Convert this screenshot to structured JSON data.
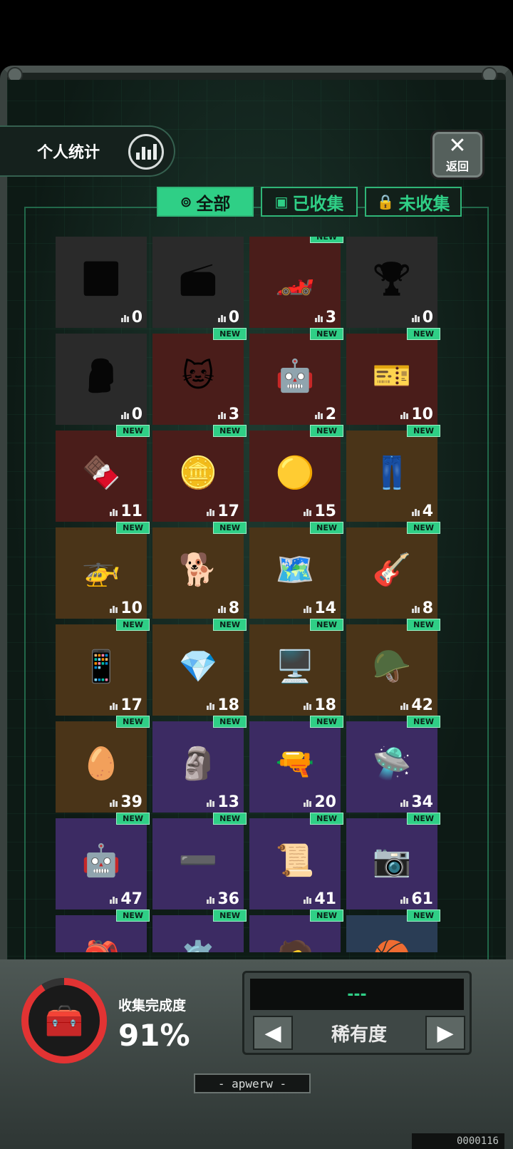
{
  "header": {
    "stats_label": "个人统计",
    "back_label": "返回"
  },
  "filters": {
    "all": "全部",
    "collected": "已收集",
    "uncollected": "未收集"
  },
  "items": [
    {
      "color": "gray",
      "icon": "🟫",
      "count": "0",
      "new": false
    },
    {
      "color": "gray",
      "icon": "📻",
      "count": "0",
      "new": false
    },
    {
      "color": "red",
      "icon": "🏎️",
      "count": "3",
      "new": true
    },
    {
      "color": "gray",
      "icon": "🏆",
      "count": "0",
      "new": false
    },
    {
      "color": "gray",
      "icon": "🗿",
      "count": "0",
      "new": false
    },
    {
      "color": "red",
      "icon": "🐱",
      "count": "3",
      "new": true
    },
    {
      "color": "red",
      "icon": "🤖",
      "count": "2",
      "new": true
    },
    {
      "color": "red",
      "icon": "🎫",
      "count": "10",
      "new": true
    },
    {
      "color": "red",
      "icon": "🍫",
      "count": "11",
      "new": true
    },
    {
      "color": "red",
      "icon": "🪙",
      "count": "17",
      "new": true
    },
    {
      "color": "red",
      "icon": "🟡",
      "count": "15",
      "new": true
    },
    {
      "color": "gold",
      "icon": "👖",
      "count": "4",
      "new": true
    },
    {
      "color": "gold",
      "icon": "🚁",
      "count": "10",
      "new": true
    },
    {
      "color": "gold",
      "icon": "🐕",
      "count": "8",
      "new": true
    },
    {
      "color": "gold",
      "icon": "🗺️",
      "count": "14",
      "new": true
    },
    {
      "color": "gold",
      "icon": "🎸",
      "count": "8",
      "new": true
    },
    {
      "color": "gold",
      "icon": "📱",
      "count": "17",
      "new": true
    },
    {
      "color": "gold",
      "icon": "💎",
      "count": "18",
      "new": true
    },
    {
      "color": "gold",
      "icon": "🖥️",
      "count": "18",
      "new": true
    },
    {
      "color": "gold",
      "icon": "🪖",
      "count": "42",
      "new": true
    },
    {
      "color": "gold",
      "icon": "🥚",
      "count": "39",
      "new": true
    },
    {
      "color": "purple",
      "icon": "🗿",
      "count": "13",
      "new": true
    },
    {
      "color": "purple",
      "icon": "🔫",
      "count": "20",
      "new": true
    },
    {
      "color": "purple",
      "icon": "🛸",
      "count": "34",
      "new": true
    },
    {
      "color": "purple",
      "icon": "🤖",
      "count": "47",
      "new": true
    },
    {
      "color": "purple",
      "icon": "➖",
      "count": "36",
      "new": true
    },
    {
      "color": "purple",
      "icon": "📜",
      "count": "41",
      "new": true
    },
    {
      "color": "purple",
      "icon": "📷",
      "count": "61",
      "new": true
    },
    {
      "color": "purple",
      "icon": "🎒",
      "count": "",
      "new": true
    },
    {
      "color": "purple",
      "icon": "⚙️",
      "count": "",
      "new": true
    },
    {
      "color": "purple",
      "icon": "🧑",
      "count": "",
      "new": true
    },
    {
      "color": "blue",
      "icon": "🏀",
      "count": "",
      "new": true
    }
  ],
  "new_badge": "NEW",
  "progress": {
    "label": "收集完成度",
    "value": "91%",
    "fraction": 0.91
  },
  "sort": {
    "display": "---",
    "label": "稀有度"
  },
  "brand": "- apwerw -",
  "serial": "0000116"
}
